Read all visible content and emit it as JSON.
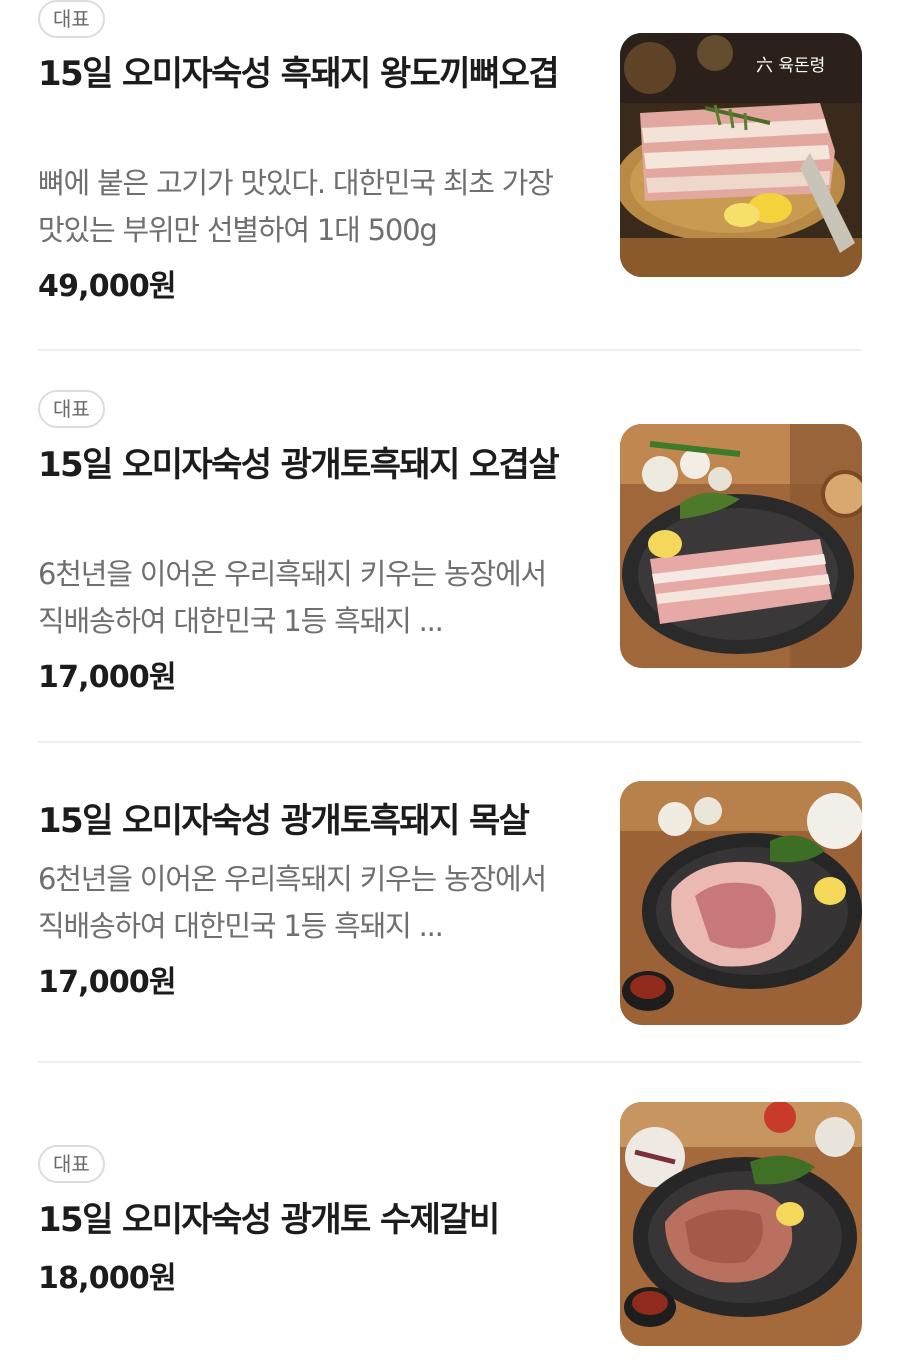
{
  "menu": {
    "items": [
      {
        "badge": "대표",
        "title": "15일 오미자숙성 흑돼지 왕도끼뼈오겹",
        "description": "뼈에 붙은 고기가 맛있다. 대한민국 최초 가장 맛있는 부위만 선별하여 1대 500g",
        "price": "49,000원",
        "image": "pork-belly-bone-on-basket-photo",
        "image_logo": "육돈령"
      },
      {
        "badge": "대표",
        "title": "15일 오미자숙성 광개토흑돼지 오겹살",
        "description": "6천년을 이어온 우리흑돼지 키우는 농장에서 직배송하여 대한민국 1등 흑돼지 ...",
        "price": "17,000원",
        "image": "pork-belly-on-plate-photo"
      },
      {
        "title": "15일 오미자숙성 광개토흑돼지 목살",
        "description": "6천년을 이어온 우리흑돼지 키우는 농장에서 직배송하여 대한민국 1등 흑돼지 ...",
        "price": "17,000원",
        "image": "pork-neck-on-plate-photo"
      },
      {
        "badge": "대표",
        "title": "15일 오미자숙성 광개토 수제갈비",
        "price": "18,000원",
        "image": "marinated-ribs-on-plate-photo"
      }
    ]
  },
  "colors": {
    "title": "#1c1c1c",
    "description": "#6f6f6f",
    "badge_border": "#dcdcdc",
    "divider": "#f0f0f0"
  }
}
